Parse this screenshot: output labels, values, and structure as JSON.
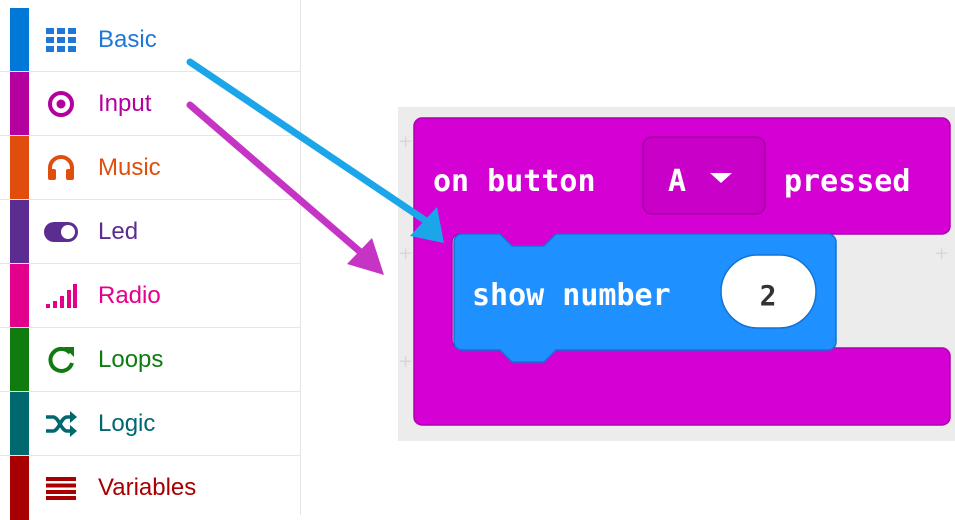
{
  "toolbox": {
    "categories": [
      {
        "label": "Basic",
        "color": "#1e90ff",
        "stripe": "#0078d7",
        "icon": "grid-icon"
      },
      {
        "label": "Input",
        "color": "#b4009e",
        "stripe": "#b4009e",
        "icon": "target-icon"
      },
      {
        "label": "Music",
        "color": "#e14d0d",
        "stripe": "#e14d0d",
        "icon": "headphones-icon"
      },
      {
        "label": "Led",
        "color": "#5c2d91",
        "stripe": "#5c2d91",
        "icon": "toggle-icon"
      },
      {
        "label": "Radio",
        "color": "#e3008c",
        "stripe": "#e3008c",
        "icon": "signal-icon"
      },
      {
        "label": "Loops",
        "color": "#107c10",
        "stripe": "#107c10",
        "icon": "refresh-icon"
      },
      {
        "label": "Logic",
        "color": "#006970",
        "stripe": "#006970",
        "icon": "shuffle-icon"
      },
      {
        "label": "Variables",
        "color": "#a80000",
        "stripe": "#a80000",
        "icon": "list-icon"
      }
    ]
  },
  "blocks": {
    "event": {
      "prefix": "on button",
      "dropdown": "A",
      "suffix": "pressed",
      "color": "#d400d4"
    },
    "statement": {
      "label": "show number",
      "value": "2",
      "color": "#1e90ff"
    }
  },
  "arrows": {
    "basic_color": "#1aa6e8",
    "input_color": "#c634c6"
  }
}
